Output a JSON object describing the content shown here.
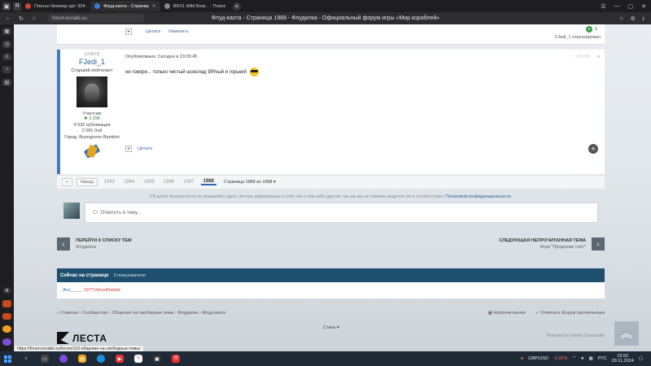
{
  "browser": {
    "tabs": [
      {
        "label": "Платье Newway арт. 924.",
        "active": false
      },
      {
        "label": "Флуд-каота - Страниц",
        "active": true
      },
      {
        "label": "BRX1 Wild Boar... - Поиск",
        "active": false
      }
    ],
    "url": "forum.korabli.su",
    "page_title": "Флуд-каота - Страница 1988 - Флудилка - Официальный форум игры «Мир кораблей»",
    "status_url": "https://forum.korabli.su/forum/119-общение-на-свободные-темы/"
  },
  "post_top": {
    "quote_label": "Цитата",
    "edit_label": "Изменить",
    "reacted_text": "FJedi_1 отреагировал",
    "reputation": "1"
  },
  "post": {
    "author_tag": "[VOKO]",
    "author_name": "FJedi_1",
    "author_rank": "Старший лейтенант",
    "author_group": "Участник",
    "author_reputation": "3 296",
    "author_posts": "4 032 публикации",
    "author_battles": "2 081 бой",
    "author_city": "Город: Buongiorno Bambini",
    "published": "Опубликовано: Сегодня в 23:05:45",
    "post_number": "#39785",
    "text": "не говори... только чистый шоколад 99%ый и горький",
    "quote_label": "Цитата"
  },
  "pager": {
    "first_label": "«",
    "prev_label": "Назад",
    "pages": [
      "1983",
      "1984",
      "1985",
      "1986",
      "1987",
      "1988"
    ],
    "current": "1988",
    "page_of": "Страница 1988 из 1988"
  },
  "privacy": {
    "text": "В целях безопасности не указывайте здесь личную информацию о себе или о ком-либо другом, так как мы не сможем защитить её в соответствии с",
    "link": "Политикой конфиденциальности."
  },
  "reply": {
    "placeholder": "Ответить в тему..."
  },
  "nav": {
    "back_title": "ПЕРЕЙТИ К СПИСКУ ТЕМ",
    "back_sub": "Флудилка",
    "next_title": "СЛЕДУЮЩАЯ НЕПРОЧИТАННАЯ ТЕМА",
    "next_sub": "Игра \"Продолжи счёт\""
  },
  "online": {
    "title": "Сейчас на странице",
    "count": "3 пользователя",
    "users": [
      "Jlex____",
      "1977VelvetRabbit"
    ]
  },
  "breadcrumbs": {
    "items": [
      "Главная",
      "Сообщество",
      "Общение на свободные темы",
      "Флудилка",
      "Флуд-каота"
    ],
    "unread": "Непрочитанное",
    "mark_read": "Отметить форум прочитанным"
  },
  "footer": {
    "logo": "ЛЕСТА",
    "style": "Стиль",
    "powered": "Powered by Invision Community"
  },
  "taskbar": {
    "ticker": "GBP/USD",
    "change": "-0,92%",
    "lang": "РУС",
    "time": "23:53",
    "date": "09.11.2024"
  },
  "colors": {
    "accent": "#3c7bd1",
    "online_header": "#1f4f6f"
  }
}
